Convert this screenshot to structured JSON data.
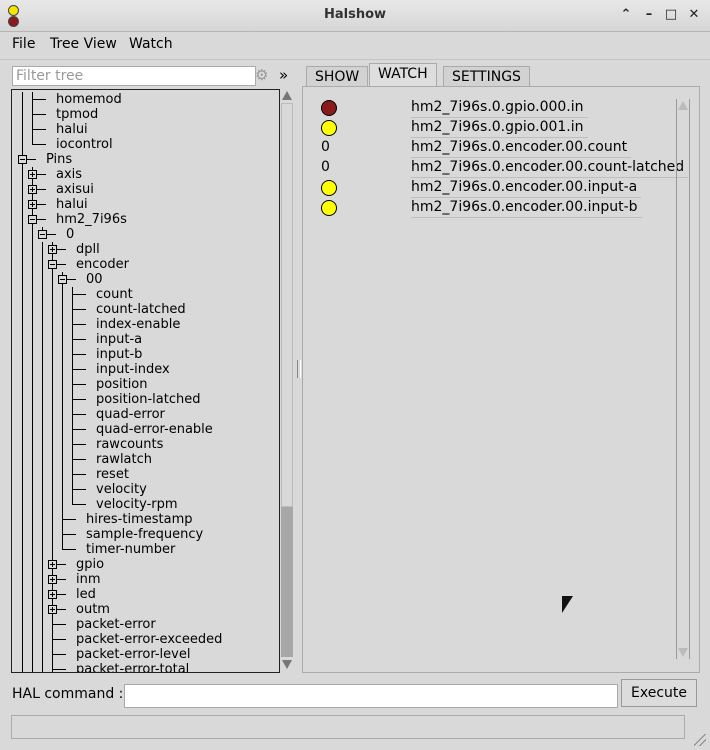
{
  "window": {
    "title": "Halshow"
  },
  "menu": {
    "file": "File",
    "tree_view": "Tree View",
    "watch": "Watch"
  },
  "filter": {
    "placeholder": "Filter tree",
    "expand_label": "»"
  },
  "tree": {
    "rows": [
      {
        "label": "homemod",
        "depth": 2,
        "node": "leaf",
        "last": false
      },
      {
        "label": "tpmod",
        "depth": 2,
        "node": "leaf",
        "last": false
      },
      {
        "label": "halui",
        "depth": 2,
        "node": "leaf",
        "last": false
      },
      {
        "label": "iocontrol",
        "depth": 2,
        "node": "leaf",
        "last": true
      },
      {
        "label": "Pins",
        "depth": 1,
        "node": "open",
        "last": false
      },
      {
        "label": "axis",
        "depth": 2,
        "node": "closed",
        "last": false
      },
      {
        "label": "axisui",
        "depth": 2,
        "node": "closed",
        "last": false
      },
      {
        "label": "halui",
        "depth": 2,
        "node": "closed",
        "last": false
      },
      {
        "label": "hm2_7i96s",
        "depth": 2,
        "node": "open",
        "last": false
      },
      {
        "label": "0",
        "depth": 3,
        "node": "open",
        "last": true
      },
      {
        "label": "dpll",
        "depth": 4,
        "node": "closed",
        "last": false
      },
      {
        "label": "encoder",
        "depth": 4,
        "node": "open",
        "last": false
      },
      {
        "label": "00",
        "depth": 5,
        "node": "open",
        "last": false
      },
      {
        "label": "count",
        "depth": 6,
        "node": "leaf",
        "last": false
      },
      {
        "label": "count-latched",
        "depth": 6,
        "node": "leaf",
        "last": false
      },
      {
        "label": "index-enable",
        "depth": 6,
        "node": "leaf",
        "last": false
      },
      {
        "label": "input-a",
        "depth": 6,
        "node": "leaf",
        "last": false
      },
      {
        "label": "input-b",
        "depth": 6,
        "node": "leaf",
        "last": false
      },
      {
        "label": "input-index",
        "depth": 6,
        "node": "leaf",
        "last": false
      },
      {
        "label": "position",
        "depth": 6,
        "node": "leaf",
        "last": false
      },
      {
        "label": "position-latched",
        "depth": 6,
        "node": "leaf",
        "last": false
      },
      {
        "label": "quad-error",
        "depth": 6,
        "node": "leaf",
        "last": false
      },
      {
        "label": "quad-error-enable",
        "depth": 6,
        "node": "leaf",
        "last": false
      },
      {
        "label": "rawcounts",
        "depth": 6,
        "node": "leaf",
        "last": false
      },
      {
        "label": "rawlatch",
        "depth": 6,
        "node": "leaf",
        "last": false
      },
      {
        "label": "reset",
        "depth": 6,
        "node": "leaf",
        "last": false
      },
      {
        "label": "velocity",
        "depth": 6,
        "node": "leaf",
        "last": false
      },
      {
        "label": "velocity-rpm",
        "depth": 6,
        "node": "leaf",
        "last": true
      },
      {
        "label": "hires-timestamp",
        "depth": 5,
        "node": "leaf",
        "last": false
      },
      {
        "label": "sample-frequency",
        "depth": 5,
        "node": "leaf",
        "last": false
      },
      {
        "label": "timer-number",
        "depth": 5,
        "node": "leaf",
        "last": true
      },
      {
        "label": "gpio",
        "depth": 4,
        "node": "closed",
        "last": false
      },
      {
        "label": "inm",
        "depth": 4,
        "node": "closed",
        "last": false
      },
      {
        "label": "led",
        "depth": 4,
        "node": "closed",
        "last": false
      },
      {
        "label": "outm",
        "depth": 4,
        "node": "closed",
        "last": false
      },
      {
        "label": "packet-error",
        "depth": 4,
        "node": "leaf",
        "last": false
      },
      {
        "label": "packet-error-exceeded",
        "depth": 4,
        "node": "leaf",
        "last": false
      },
      {
        "label": "packet-error-level",
        "depth": 4,
        "node": "leaf",
        "last": false
      },
      {
        "label": "packet-error-total",
        "depth": 4,
        "node": "leaf",
        "last": false
      }
    ]
  },
  "tabs": [
    {
      "label": "SHOW",
      "active": false
    },
    {
      "label": "WATCH",
      "active": true
    },
    {
      "label": "SETTINGS",
      "active": false
    }
  ],
  "watch": {
    "items": [
      {
        "kind": "bit",
        "state": "off",
        "color": "#8b1a1a",
        "name": "hm2_7i96s.0.gpio.000.in"
      },
      {
        "kind": "bit",
        "state": "on",
        "color": "#ffff00",
        "name": "hm2_7i96s.0.gpio.001.in"
      },
      {
        "kind": "value",
        "value": "0",
        "name": "hm2_7i96s.0.encoder.00.count"
      },
      {
        "kind": "value",
        "value": "0",
        "name": "hm2_7i96s.0.encoder.00.count-latched"
      },
      {
        "kind": "bit",
        "state": "on",
        "color": "#ffff00",
        "name": "hm2_7i96s.0.encoder.00.input-a"
      },
      {
        "kind": "bit",
        "state": "on",
        "color": "#ffff00",
        "name": "hm2_7i96s.0.encoder.00.input-b"
      }
    ]
  },
  "command": {
    "label": "HAL command :",
    "value": "",
    "execute_label": "Execute"
  },
  "status": {
    "text": ""
  }
}
